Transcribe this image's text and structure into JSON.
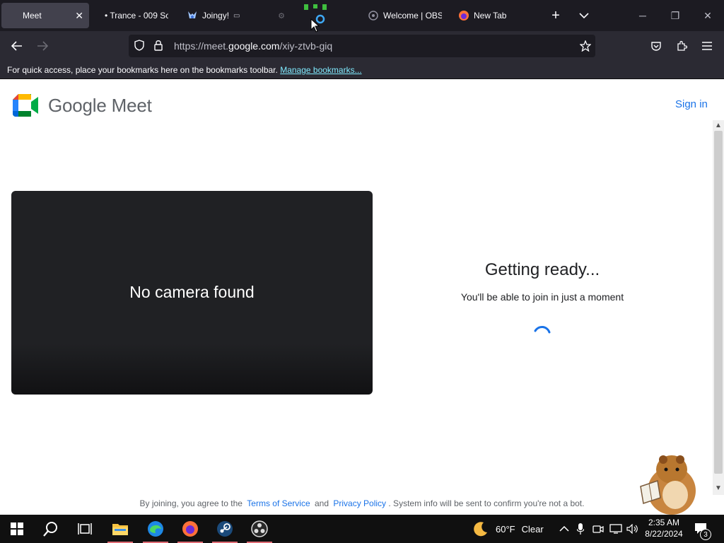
{
  "tabs": [
    {
      "title": "Meet",
      "active": true,
      "close": "✕"
    },
    {
      "title": "• Trance - 009 So",
      "active": false
    },
    {
      "title": "Joingy!",
      "active": false
    },
    {
      "title": "Welcome | OBS",
      "active": false
    },
    {
      "title": "New Tab",
      "active": false
    }
  ],
  "toolbar": {
    "new_tab": "+",
    "list_tabs": "⌄"
  },
  "window_controls": {
    "minimize": "─",
    "restore": "❐",
    "close": "✕"
  },
  "url": {
    "prefix": "https://meet.",
    "host": "google.com",
    "path": "/xiy-ztvb-giq"
  },
  "bookmarks_bar": {
    "text": "For quick access, place your bookmarks here on the bookmarks toolbar.",
    "link": "Manage bookmarks..."
  },
  "page": {
    "logo_text": "Google Meet",
    "sign_in": "Sign in",
    "camera_message": "No camera found",
    "status_title": "Getting ready...",
    "status_sub": "You'll be able to join in just a moment",
    "footer": {
      "prefix": "By joining, you agree to the",
      "terms": "Terms of Service",
      "and": "and",
      "privacy": "Privacy Policy",
      "suffix": ". System info will be sent to confirm you're not a bot."
    }
  },
  "taskbar": {
    "weather_temp": "60°F",
    "weather_text": "Clear",
    "time": "2:35 AM",
    "date": "8/22/2024",
    "notification_count": "3"
  },
  "colors": {
    "accent": "#1a73e8",
    "tab_strip": "#1c1b22",
    "nav_bar": "#2b2a33",
    "taskbar": "#101010"
  }
}
